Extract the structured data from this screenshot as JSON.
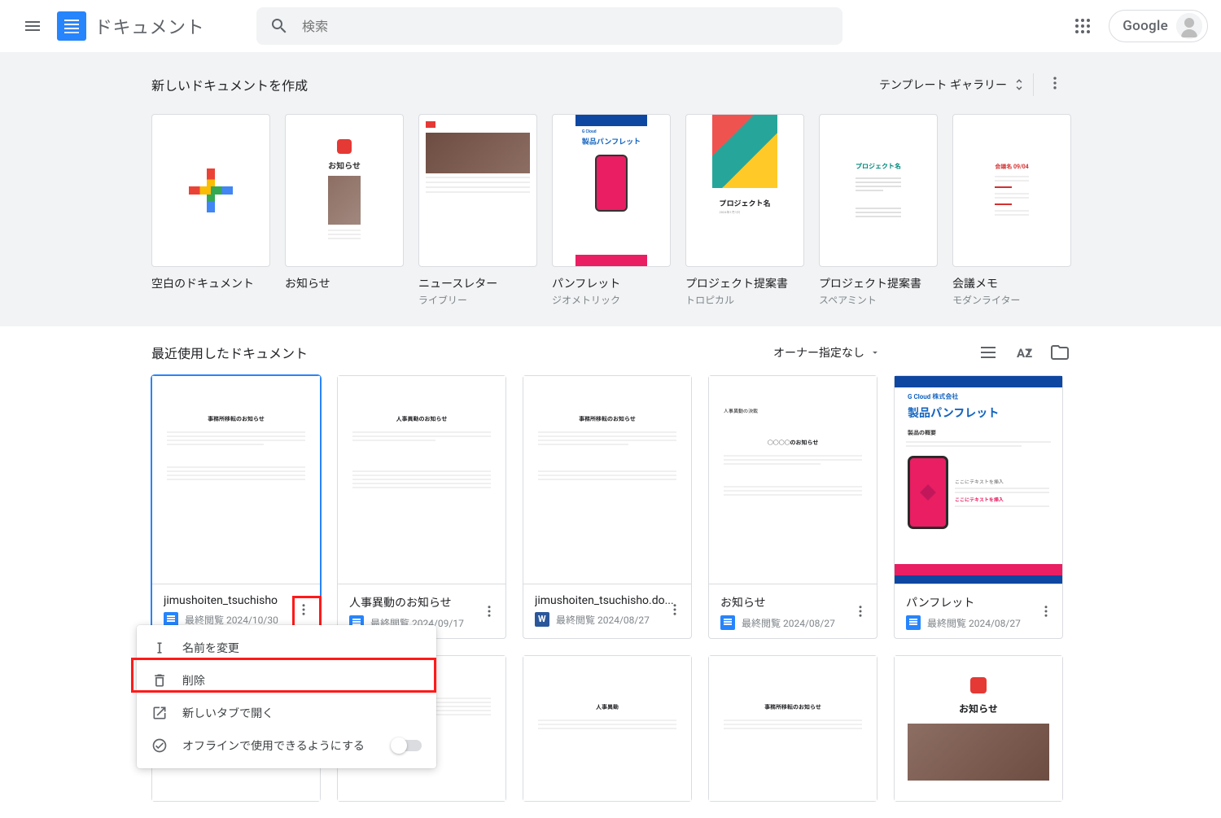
{
  "header": {
    "app_name": "ドキュメント",
    "search_placeholder": "検索",
    "google_label": "Google"
  },
  "templates": {
    "section_title": "新しいドキュメントを作成",
    "gallery_link": "テンプレート ギャラリー",
    "items": [
      {
        "name": "空白のドキュメント",
        "sub": ""
      },
      {
        "name": "お知らせ",
        "sub": ""
      },
      {
        "name": "ニュースレター",
        "sub": "ライブリー"
      },
      {
        "name": "パンフレット",
        "sub": "ジオメトリック"
      },
      {
        "name": "プロジェクト提案書",
        "sub": "トロピカル"
      },
      {
        "name": "プロジェクト提案書",
        "sub": "スペアミント"
      },
      {
        "name": "会議メモ",
        "sub": "モダンライター"
      }
    ]
  },
  "recent": {
    "section_title": "最近使用したドキュメント",
    "owner_label": "オーナー指定なし",
    "docs": [
      {
        "name": "jimushoiten_tsuchisho",
        "date": "最終閲覧 2024/10/30",
        "icon": "doc"
      },
      {
        "name": "人事異動のお知らせ",
        "date": "最終閲覧 2024/09/17",
        "icon": "doc"
      },
      {
        "name": "jimushoiten_tsuchisho.do...",
        "date": "最終閲覧 2024/08/27",
        "icon": "word"
      },
      {
        "name": "お知らせ",
        "date": "最終閲覧 2024/08/27",
        "icon": "doc"
      },
      {
        "name": "パンフレット",
        "date": "最終閲覧 2024/08/27",
        "icon": "doc"
      }
    ]
  },
  "brochure": {
    "company": "G Cloud 株式会社",
    "title": "製品パンフレット",
    "desc": "製品の概要",
    "side1": "ここにテキストを挿入",
    "side2": "ここにテキストを挿入"
  },
  "context_menu": {
    "rename": "名前を変更",
    "delete": "削除",
    "new_tab": "新しいタブで開く",
    "offline": "オフラインで使用できるようにする"
  },
  "fake": {
    "notice_title": "お知らせ",
    "brochure_co": "G Cloud",
    "brochure_title": "製品パンフレット",
    "project": "プロジェクト名",
    "meeting": "会議名 09/04",
    "doc_title1": "事務所移転のお知らせ",
    "doc_title2": "人事異動のお知らせ",
    "doc_title3": "事務所移転のお知らせ",
    "doc_title4": "○○○○のお知らせ"
  }
}
